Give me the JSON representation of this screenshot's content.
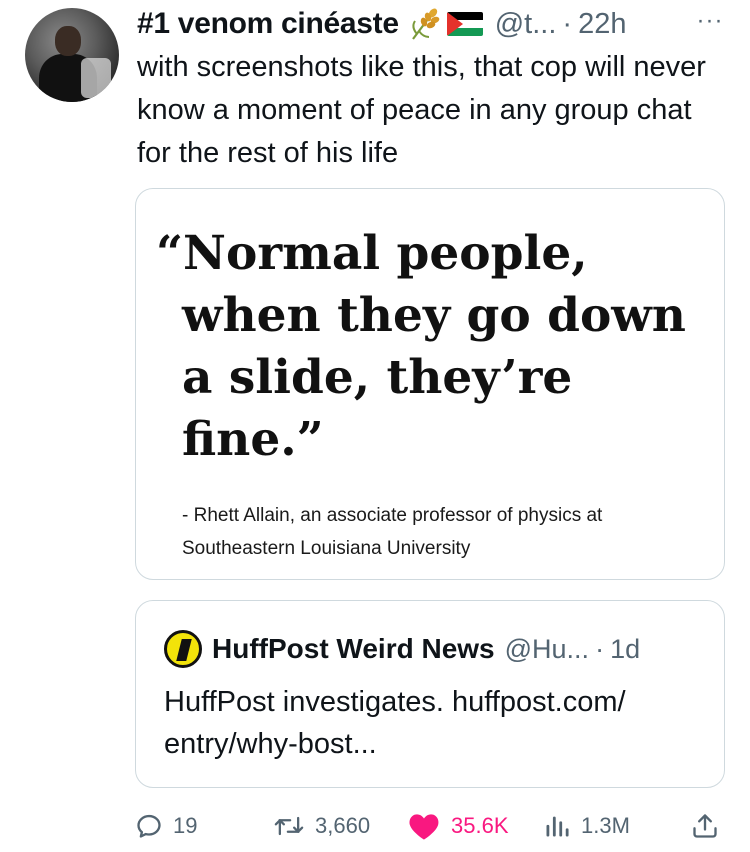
{
  "tweet": {
    "author_name": "#1 venom cinéaste",
    "handle": "@t...",
    "separator": "·",
    "time": "22h",
    "body": "with screenshots like this, that cop will never know a moment of peace in any group chat for the rest of his life",
    "more_label": "···"
  },
  "quote_image": {
    "quote_lines": [
      "“Normal people,",
      "when they go down",
      "a slide, they’re",
      "fine.”"
    ],
    "attribution": "- Rhett Allain, an associate professor of physics at Southeastern Louisiana University"
  },
  "quoted_tweet": {
    "author_name": "HuffPost Weird News",
    "handle": "@Hu...",
    "separator": "·",
    "time": "1d",
    "body": "HuffPost investigates. huffpost.com/ entry/why-bost..."
  },
  "actions": {
    "replies": "19",
    "retweets": "3,660",
    "likes": "35.6K",
    "views": "1.3M"
  },
  "colors": {
    "secondary_text": "#536471",
    "like_pink": "#f91880",
    "border": "#cfd9de",
    "huffpost_yellow": "#f2e30a"
  },
  "icons": [
    "more-icon",
    "wheat-icon",
    "palestine-flag-icon",
    "huffpost-logo-icon",
    "reply-icon",
    "retweet-icon",
    "like-icon",
    "views-icon",
    "share-icon"
  ]
}
